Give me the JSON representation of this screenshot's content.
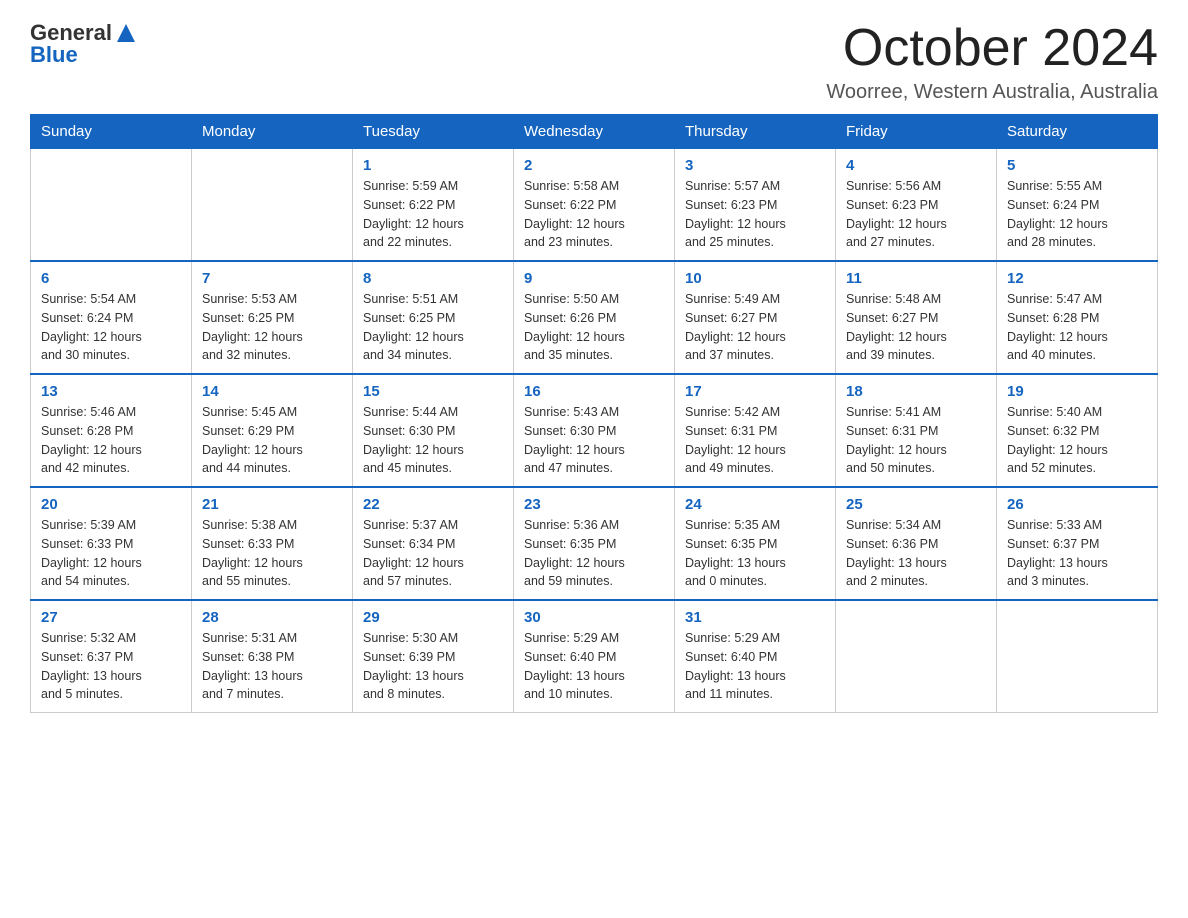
{
  "header": {
    "logo_general": "General",
    "logo_blue": "Blue",
    "title": "October 2024",
    "subtitle": "Woorree, Western Australia, Australia"
  },
  "calendar": {
    "days_of_week": [
      "Sunday",
      "Monday",
      "Tuesday",
      "Wednesday",
      "Thursday",
      "Friday",
      "Saturday"
    ],
    "weeks": [
      [
        {
          "day": "",
          "info": ""
        },
        {
          "day": "",
          "info": ""
        },
        {
          "day": "1",
          "info": "Sunrise: 5:59 AM\nSunset: 6:22 PM\nDaylight: 12 hours\nand 22 minutes."
        },
        {
          "day": "2",
          "info": "Sunrise: 5:58 AM\nSunset: 6:22 PM\nDaylight: 12 hours\nand 23 minutes."
        },
        {
          "day": "3",
          "info": "Sunrise: 5:57 AM\nSunset: 6:23 PM\nDaylight: 12 hours\nand 25 minutes."
        },
        {
          "day": "4",
          "info": "Sunrise: 5:56 AM\nSunset: 6:23 PM\nDaylight: 12 hours\nand 27 minutes."
        },
        {
          "day": "5",
          "info": "Sunrise: 5:55 AM\nSunset: 6:24 PM\nDaylight: 12 hours\nand 28 minutes."
        }
      ],
      [
        {
          "day": "6",
          "info": "Sunrise: 5:54 AM\nSunset: 6:24 PM\nDaylight: 12 hours\nand 30 minutes."
        },
        {
          "day": "7",
          "info": "Sunrise: 5:53 AM\nSunset: 6:25 PM\nDaylight: 12 hours\nand 32 minutes."
        },
        {
          "day": "8",
          "info": "Sunrise: 5:51 AM\nSunset: 6:25 PM\nDaylight: 12 hours\nand 34 minutes."
        },
        {
          "day": "9",
          "info": "Sunrise: 5:50 AM\nSunset: 6:26 PM\nDaylight: 12 hours\nand 35 minutes."
        },
        {
          "day": "10",
          "info": "Sunrise: 5:49 AM\nSunset: 6:27 PM\nDaylight: 12 hours\nand 37 minutes."
        },
        {
          "day": "11",
          "info": "Sunrise: 5:48 AM\nSunset: 6:27 PM\nDaylight: 12 hours\nand 39 minutes."
        },
        {
          "day": "12",
          "info": "Sunrise: 5:47 AM\nSunset: 6:28 PM\nDaylight: 12 hours\nand 40 minutes."
        }
      ],
      [
        {
          "day": "13",
          "info": "Sunrise: 5:46 AM\nSunset: 6:28 PM\nDaylight: 12 hours\nand 42 minutes."
        },
        {
          "day": "14",
          "info": "Sunrise: 5:45 AM\nSunset: 6:29 PM\nDaylight: 12 hours\nand 44 minutes."
        },
        {
          "day": "15",
          "info": "Sunrise: 5:44 AM\nSunset: 6:30 PM\nDaylight: 12 hours\nand 45 minutes."
        },
        {
          "day": "16",
          "info": "Sunrise: 5:43 AM\nSunset: 6:30 PM\nDaylight: 12 hours\nand 47 minutes."
        },
        {
          "day": "17",
          "info": "Sunrise: 5:42 AM\nSunset: 6:31 PM\nDaylight: 12 hours\nand 49 minutes."
        },
        {
          "day": "18",
          "info": "Sunrise: 5:41 AM\nSunset: 6:31 PM\nDaylight: 12 hours\nand 50 minutes."
        },
        {
          "day": "19",
          "info": "Sunrise: 5:40 AM\nSunset: 6:32 PM\nDaylight: 12 hours\nand 52 minutes."
        }
      ],
      [
        {
          "day": "20",
          "info": "Sunrise: 5:39 AM\nSunset: 6:33 PM\nDaylight: 12 hours\nand 54 minutes."
        },
        {
          "day": "21",
          "info": "Sunrise: 5:38 AM\nSunset: 6:33 PM\nDaylight: 12 hours\nand 55 minutes."
        },
        {
          "day": "22",
          "info": "Sunrise: 5:37 AM\nSunset: 6:34 PM\nDaylight: 12 hours\nand 57 minutes."
        },
        {
          "day": "23",
          "info": "Sunrise: 5:36 AM\nSunset: 6:35 PM\nDaylight: 12 hours\nand 59 minutes."
        },
        {
          "day": "24",
          "info": "Sunrise: 5:35 AM\nSunset: 6:35 PM\nDaylight: 13 hours\nand 0 minutes."
        },
        {
          "day": "25",
          "info": "Sunrise: 5:34 AM\nSunset: 6:36 PM\nDaylight: 13 hours\nand 2 minutes."
        },
        {
          "day": "26",
          "info": "Sunrise: 5:33 AM\nSunset: 6:37 PM\nDaylight: 13 hours\nand 3 minutes."
        }
      ],
      [
        {
          "day": "27",
          "info": "Sunrise: 5:32 AM\nSunset: 6:37 PM\nDaylight: 13 hours\nand 5 minutes."
        },
        {
          "day": "28",
          "info": "Sunrise: 5:31 AM\nSunset: 6:38 PM\nDaylight: 13 hours\nand 7 minutes."
        },
        {
          "day": "29",
          "info": "Sunrise: 5:30 AM\nSunset: 6:39 PM\nDaylight: 13 hours\nand 8 minutes."
        },
        {
          "day": "30",
          "info": "Sunrise: 5:29 AM\nSunset: 6:40 PM\nDaylight: 13 hours\nand 10 minutes."
        },
        {
          "day": "31",
          "info": "Sunrise: 5:29 AM\nSunset: 6:40 PM\nDaylight: 13 hours\nand 11 minutes."
        },
        {
          "day": "",
          "info": ""
        },
        {
          "day": "",
          "info": ""
        }
      ]
    ]
  }
}
